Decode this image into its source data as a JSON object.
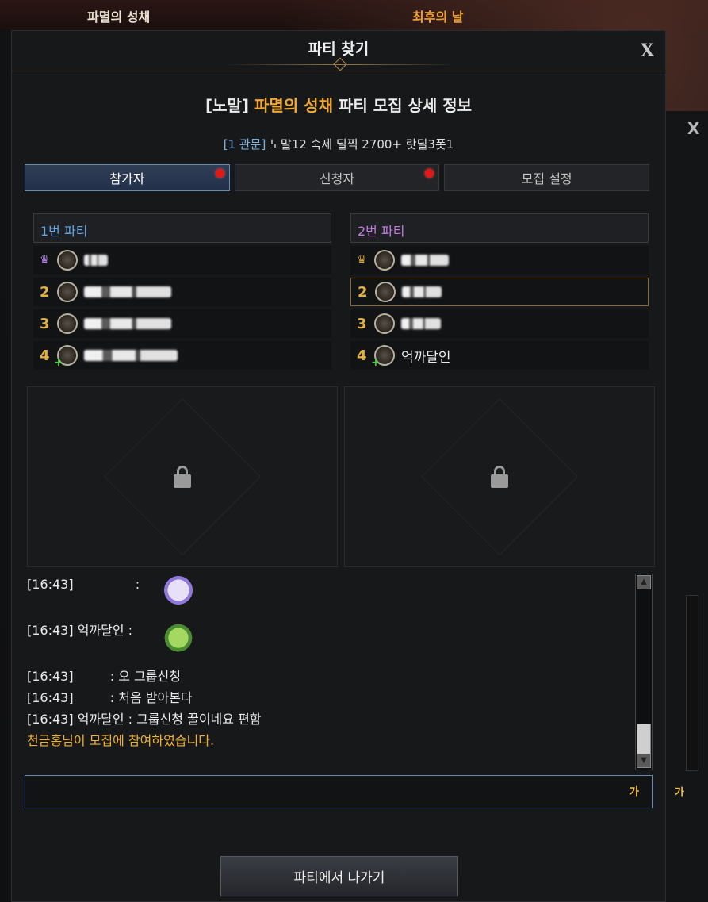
{
  "background": {
    "top_tabs": [
      "파멸의 성채",
      "최후의 날"
    ],
    "side_close": "X",
    "side_ga": "가"
  },
  "window": {
    "title": "파티 찾기",
    "close_label": "X",
    "heading_prefix": "[노말]",
    "heading_dungeon": "파멸의 성채",
    "heading_suffix": "파티 모집 상세 정보",
    "gate": "[1 관문]",
    "description": "노말12 숙제 딜찍 2700+ 랏딜3폿1"
  },
  "tabs": [
    {
      "label": "참가자",
      "active": true,
      "alert": true
    },
    {
      "label": "신청자",
      "active": false,
      "alert": true
    },
    {
      "label": "모집 설정",
      "active": false,
      "alert": false
    }
  ],
  "parties": [
    {
      "title": "1번 파티",
      "members": [
        {
          "slot": "",
          "leader": true,
          "name": ""
        },
        {
          "slot": "2",
          "leader": false,
          "name": ""
        },
        {
          "slot": "3",
          "leader": false,
          "name": ""
        },
        {
          "slot": "4",
          "leader": false,
          "name": ""
        }
      ]
    },
    {
      "title": "2번 파티",
      "members": [
        {
          "slot": "",
          "leader": true,
          "name": ""
        },
        {
          "slot": "2",
          "leader": false,
          "name": ""
        },
        {
          "slot": "3",
          "leader": false,
          "name": ""
        },
        {
          "slot": "4",
          "leader": false,
          "name": "억까달인"
        }
      ]
    }
  ],
  "chat": {
    "lines": [
      {
        "time": "[16:43]",
        "speaker": "",
        "text": " :",
        "emote": true
      },
      {
        "time": "[16:43]",
        "speaker": "억까달인",
        "text": " :",
        "emote": true
      },
      {
        "time": "[16:43]",
        "speaker": "",
        "text": " : 오 그룹신청",
        "emote": false
      },
      {
        "time": "[16:43]",
        "speaker": "",
        "text": " : 처음 받아본다",
        "emote": false
      },
      {
        "time": "[16:43]",
        "speaker": "억까달인",
        "text": " : 그룹신청 꿀이네요 편함",
        "emote": false
      }
    ],
    "system_message": "천금홍님이 모집에 참여하였습니다.",
    "input_value": "",
    "input_lang_label": "가"
  },
  "leave_button": "파티에서 나가기",
  "colors": {
    "accent_gold": "#f0a830",
    "party1": "#62a8ea",
    "party2": "#c37be4",
    "alert_dot": "#e01818"
  }
}
